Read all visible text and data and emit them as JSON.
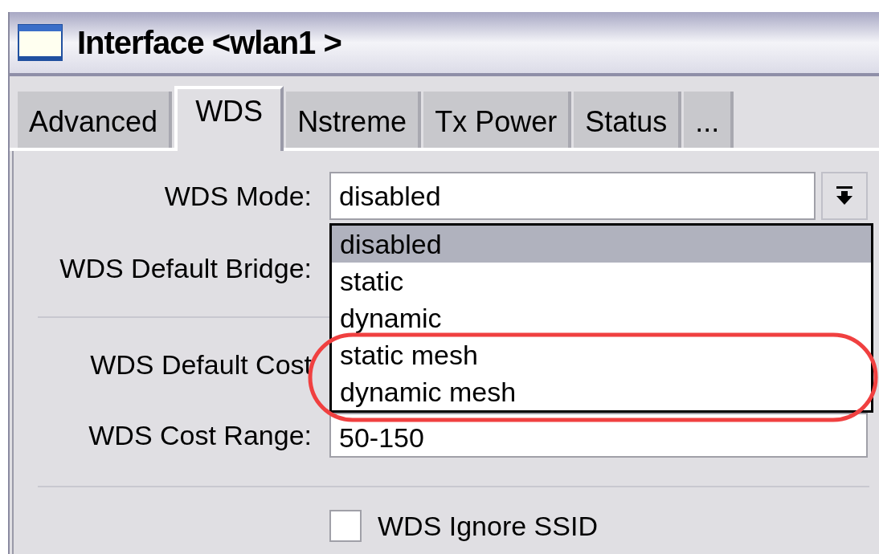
{
  "window": {
    "title": "Interface <wlan1 >"
  },
  "tabs": [
    {
      "label": "Advanced",
      "selected": false
    },
    {
      "label": "WDS",
      "selected": true
    },
    {
      "label": "Nstreme",
      "selected": false
    },
    {
      "label": "Tx Power",
      "selected": false
    },
    {
      "label": "Status",
      "selected": false
    },
    {
      "label": "...",
      "selected": false
    }
  ],
  "wds_mode": {
    "label": "WDS Mode:",
    "value": "disabled",
    "expanded": true
  },
  "wds_mode_options": [
    {
      "label": "disabled",
      "selected": true
    },
    {
      "label": "static",
      "selected": false
    },
    {
      "label": "dynamic",
      "selected": false
    },
    {
      "label": "static mesh",
      "selected": false
    },
    {
      "label": "dynamic mesh",
      "selected": false
    }
  ],
  "default_bridge": {
    "label": "WDS Default Bridge:"
  },
  "default_cost": {
    "label": "WDS Default Cost"
  },
  "cost_range": {
    "label": "WDS Cost Range:",
    "value": "50-150"
  },
  "ignore_ssid": {
    "label": "WDS Ignore SSID",
    "checked": false
  }
}
